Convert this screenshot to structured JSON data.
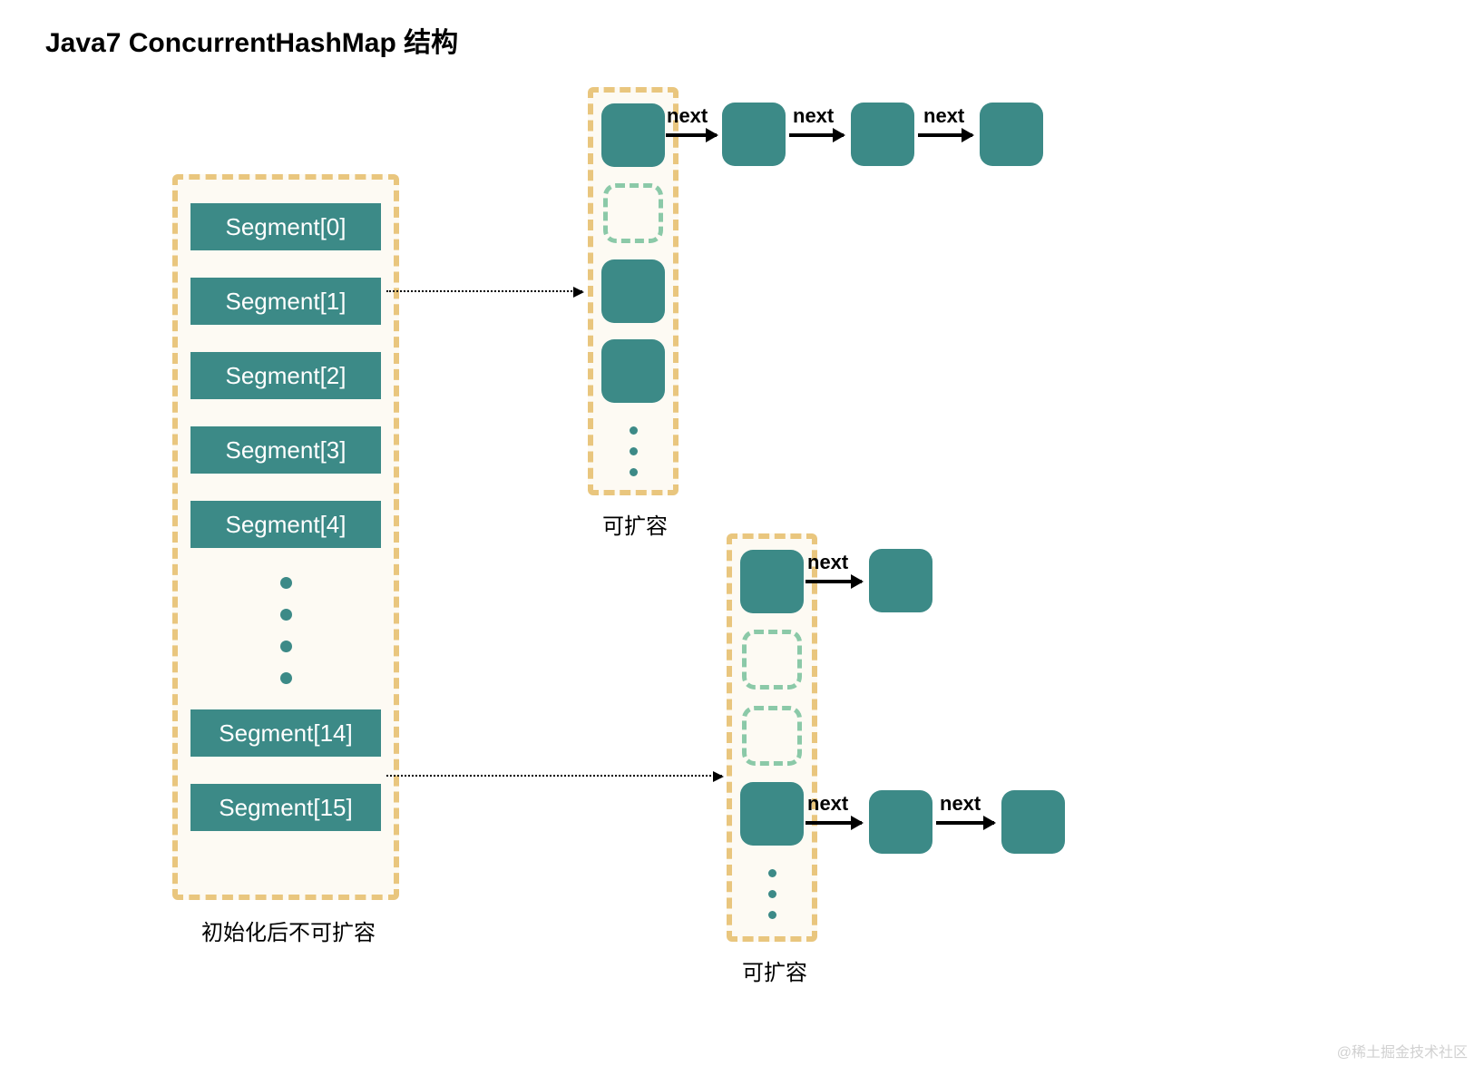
{
  "title": "Java7 ConcurrentHashMap 结构",
  "segments_caption": "初始化后不可扩容",
  "expandable_caption_top": "可扩容",
  "expandable_caption_bottom": "可扩容",
  "segments": {
    "s0": "Segment[0]",
    "s1": "Segment[1]",
    "s2": "Segment[2]",
    "s3": "Segment[3]",
    "s4": "Segment[4]",
    "s14": "Segment[14]",
    "s15": "Segment[15]"
  },
  "next_label": "next",
  "watermark": "@稀土掘金技术社区",
  "colors": {
    "node": "#3c8a87",
    "dash_orange": "#e9c67e",
    "dash_green": "#8bc9a8"
  }
}
